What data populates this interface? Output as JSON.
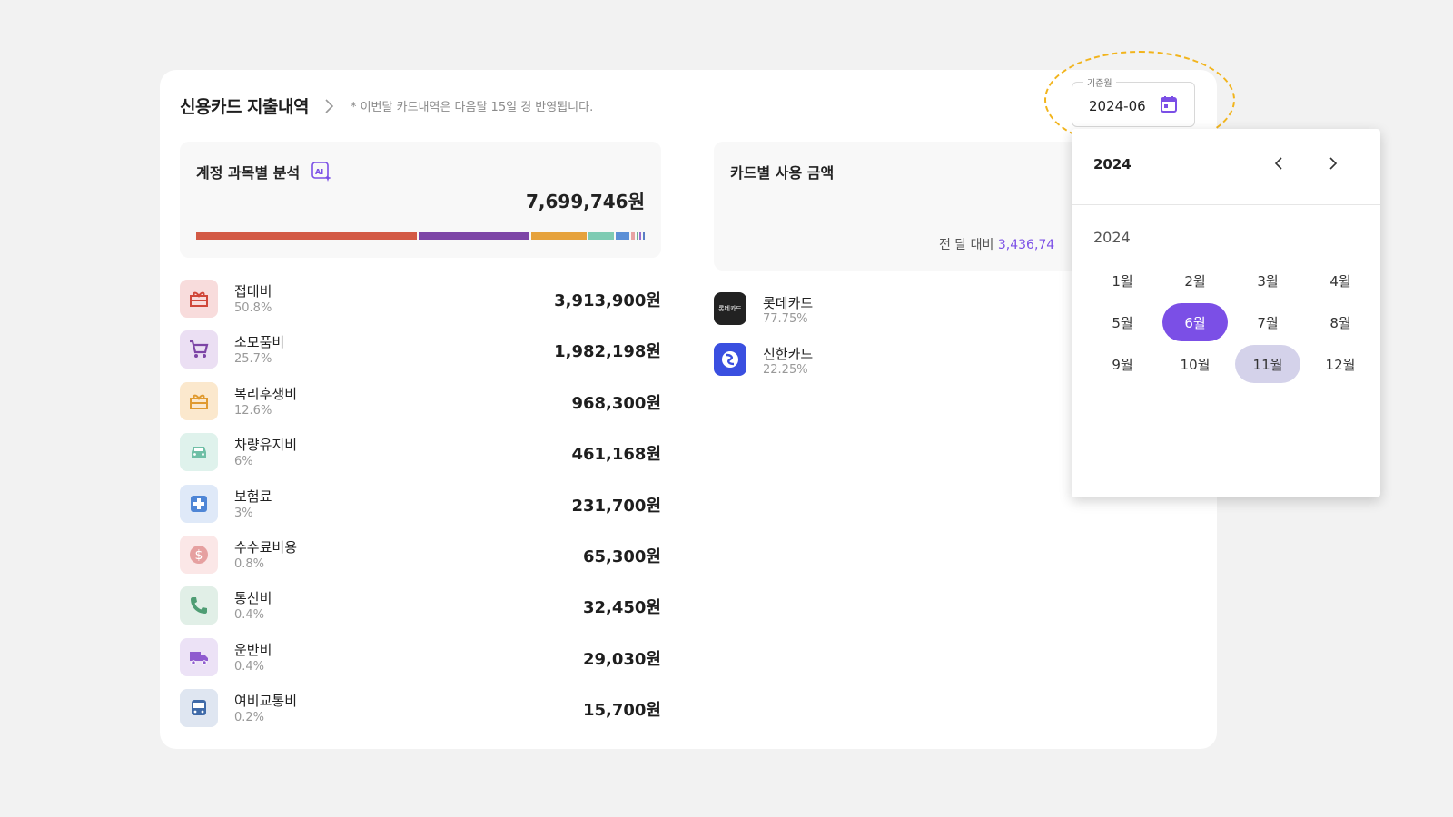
{
  "header": {
    "title": "신용카드 지출내역",
    "note": "* 이번달 카드내역은 다음달 15일 경 반영됩니다."
  },
  "analysis": {
    "title": "계정 과목별 분석",
    "total": "7,699,746원",
    "bar_colors": [
      "#d35a45",
      "#7d45a6",
      "#e6a23c",
      "#7ecbb3",
      "#5b8fd6",
      "#e8a3a3",
      "#6fae8f",
      "#9a6dd0",
      "#5a7ec4"
    ],
    "categories": [
      {
        "name": "접대비",
        "pct": "50.8%",
        "amount": "3,913,900원",
        "icon": "gift-icon",
        "bg": "#f8dcdc",
        "fg": "#d0473a",
        "share": 50.8
      },
      {
        "name": "소모품비",
        "pct": "25.7%",
        "amount": "1,982,198원",
        "icon": "cart-icon",
        "bg": "#ebdff3",
        "fg": "#7d45a6",
        "share": 25.7
      },
      {
        "name": "복리후생비",
        "pct": "12.6%",
        "amount": "968,300원",
        "icon": "gift-icon",
        "bg": "#fbe8cd",
        "fg": "#e09a2f",
        "share": 12.6
      },
      {
        "name": "차량유지비",
        "pct": "6%",
        "amount": "461,168원",
        "icon": "car-icon",
        "bg": "#dff2ec",
        "fg": "#6fbfa6",
        "share": 6
      },
      {
        "name": "보험료",
        "pct": "3%",
        "amount": "231,700원",
        "icon": "medical-cross-icon",
        "bg": "#dfe9f8",
        "fg": "#4f86d6",
        "share": 3
      },
      {
        "name": "수수료비용",
        "pct": "0.8%",
        "amount": "65,300원",
        "icon": "dollar-coin-icon",
        "bg": "#fbe7e7",
        "fg": "#e6a0a0",
        "share": 0.8
      },
      {
        "name": "통신비",
        "pct": "0.4%",
        "amount": "32,450원",
        "icon": "phone-icon",
        "bg": "#e1efe7",
        "fg": "#4f9d74",
        "share": 0.4
      },
      {
        "name": "운반비",
        "pct": "0.4%",
        "amount": "29,030원",
        "icon": "truck-icon",
        "bg": "#ece2f6",
        "fg": "#8f5bcf",
        "share": 0.4
      },
      {
        "name": "여비교통비",
        "pct": "0.2%",
        "amount": "15,700원",
        "icon": "bus-icon",
        "bg": "#dfe6f1",
        "fg": "#3f6aa8",
        "share": 0.2
      }
    ]
  },
  "card_usage": {
    "title": "카드별 사용 금액",
    "compare_label": "전 달 대비",
    "compare_value": "3,436,74",
    "cards": [
      {
        "name": "롯데카드",
        "pct": "77.75%",
        "logo_text": "롯데카드",
        "logo_bg": "#222222"
      },
      {
        "name": "신한카드",
        "pct": "22.25%",
        "logo_text": "",
        "logo_bg": "#3a4fe0"
      }
    ]
  },
  "date_field": {
    "label": "기준월",
    "value": "2024-06"
  },
  "month_picker": {
    "header_year": "2024",
    "sub_year": "2024",
    "months": [
      "1월",
      "2월",
      "3월",
      "4월",
      "5월",
      "6월",
      "7월",
      "8월",
      "9월",
      "10월",
      "11월",
      "12월"
    ],
    "selected": "6월",
    "hovered": "11월",
    "accent": "#7b4fe6"
  }
}
